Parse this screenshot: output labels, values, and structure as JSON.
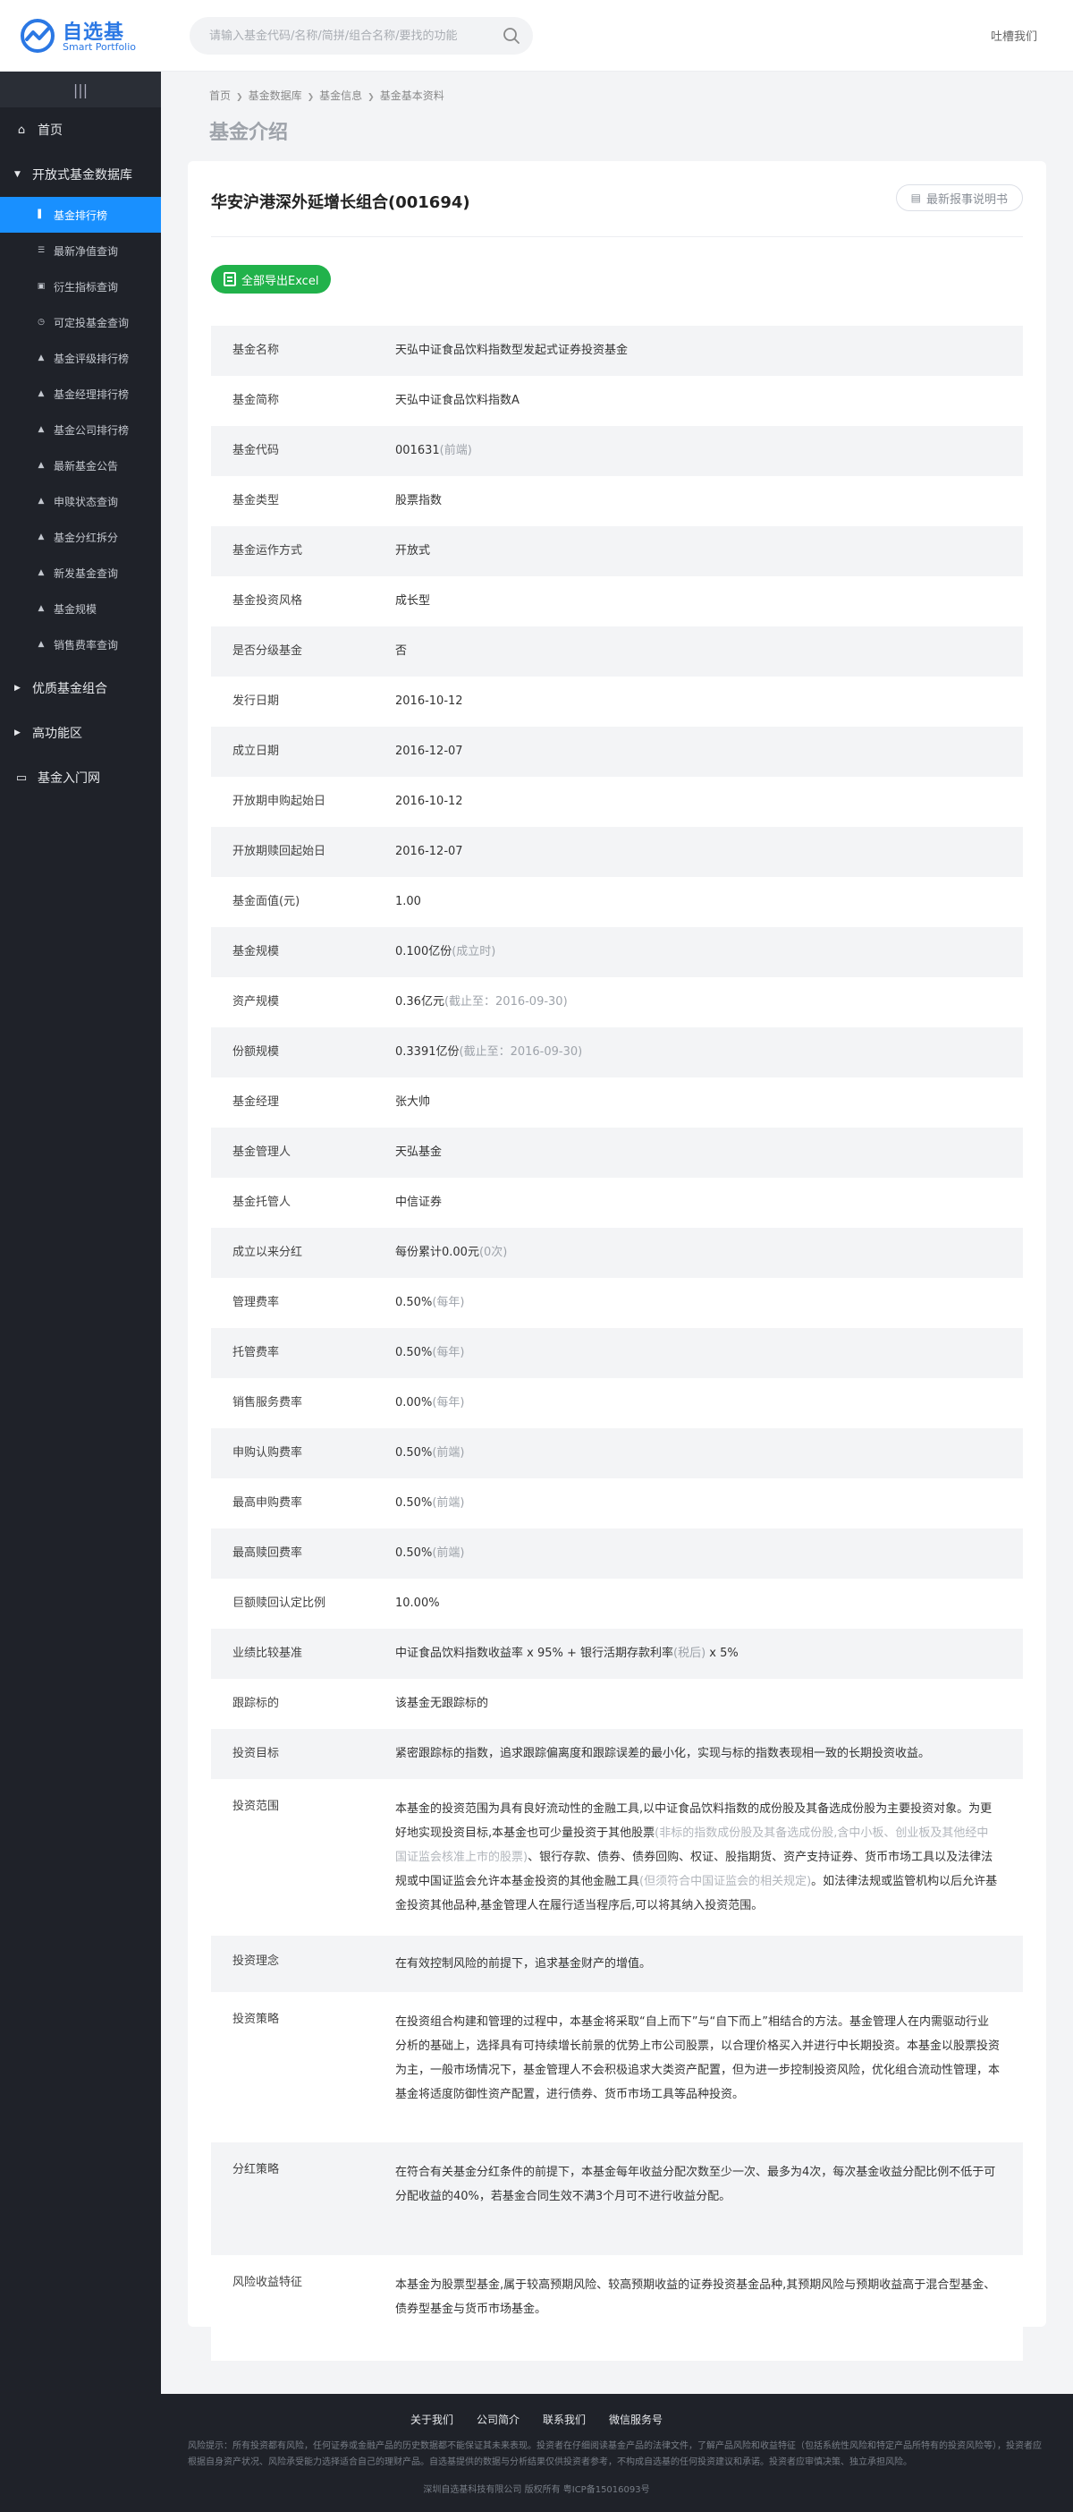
{
  "app": {
    "logo_name": "自选基",
    "logo_sub": "Smart Portfolio",
    "search_placeholder": "请输入基金代码/名称/简拼/组合名称/要找的功能",
    "feedback": "吐槽我们"
  },
  "sidebar": {
    "collapse_glyph": "|||",
    "home": "首页",
    "group_open": "开放式基金数据库",
    "items": [
      {
        "label": "基金排行榜",
        "icon": "bar-chart-icon",
        "glyph": "▌",
        "active": true
      },
      {
        "label": "最新净值查询",
        "icon": "database-icon",
        "glyph": "☰",
        "active": false
      },
      {
        "label": "衍生指标查询",
        "icon": "image-icon",
        "glyph": "▣",
        "active": false
      },
      {
        "label": "可定投基金查询",
        "icon": "clock-icon",
        "glyph": "◷",
        "active": false
      },
      {
        "label": "基金评级排行榜",
        "icon": "triangle-icon",
        "glyph": "▲",
        "active": false
      },
      {
        "label": "基金经理排行榜",
        "icon": "triangle-icon",
        "glyph": "▲",
        "active": false
      },
      {
        "label": "基金公司排行榜",
        "icon": "triangle-icon",
        "glyph": "▲",
        "active": false
      },
      {
        "label": "最新基金公告",
        "icon": "triangle-icon",
        "glyph": "▲",
        "active": false
      },
      {
        "label": "申赎状态查询",
        "icon": "triangle-icon",
        "glyph": "▲",
        "active": false
      },
      {
        "label": "基金分红拆分",
        "icon": "triangle-icon",
        "glyph": "▲",
        "active": false
      },
      {
        "label": "新发基金查询",
        "icon": "triangle-icon",
        "glyph": "▲",
        "active": false
      },
      {
        "label": "基金规模",
        "icon": "triangle-icon",
        "glyph": "▲",
        "active": false
      },
      {
        "label": "销售费率查询",
        "icon": "triangle-icon",
        "glyph": "▲",
        "active": false
      }
    ],
    "group_2": "优质基金组合",
    "group_3": "高功能区",
    "intro": "基金入门网"
  },
  "breadcrumb": [
    "首页",
    "基金数据库",
    "基金信息",
    "基金基本资料"
  ],
  "page_title": "基金介绍",
  "card": {
    "fund_title": "华安沪港深外延增长组合(001694)",
    "guide_button": "最新报事说明书",
    "export_button": "全部导出Excel"
  },
  "rows": [
    {
      "label": "基金名称",
      "value": "天弘中证食品饮料指数型发起式证券投资基金"
    },
    {
      "label": "基金简称",
      "value": "天弘中证食品饮料指数A"
    },
    {
      "label": "基金代码",
      "value": "001631",
      "note": "(前端)"
    },
    {
      "label": "基金类型",
      "value": "股票指数"
    },
    {
      "label": "基金运作方式",
      "value": "开放式"
    },
    {
      "label": "基金投资风格",
      "value": "成长型"
    },
    {
      "label": "是否分级基金",
      "value": "否"
    },
    {
      "label": "发行日期",
      "value": "2016-10-12"
    },
    {
      "label": "成立日期",
      "value": "2016-12-07"
    },
    {
      "label": "开放期申购起始日",
      "value": "2016-10-12"
    },
    {
      "label": "开放期赎回起始日",
      "value": "2016-12-07"
    },
    {
      "label": "基金面值(元)",
      "value": "1.00"
    },
    {
      "label": "基金规模",
      "value": "0.100亿份",
      "note": "(成立时)"
    },
    {
      "label": "资产规模",
      "value": "0.36亿元",
      "note": "(截止至：2016-09-30)"
    },
    {
      "label": "份额规模",
      "value": "0.3391亿份",
      "note": "(截止至：2016-09-30)"
    },
    {
      "label": "基金经理",
      "value": "张大帅"
    },
    {
      "label": "基金管理人",
      "value": "天弘基金"
    },
    {
      "label": "基金托管人",
      "value": "中信证券"
    },
    {
      "label": "成立以来分红",
      "value": "每份累计0.00元",
      "note": "(0次)"
    },
    {
      "label": "管理费率",
      "value": "0.50%",
      "note": "(每年)"
    },
    {
      "label": "托管费率",
      "value": "0.50%",
      "note": "(每年)"
    },
    {
      "label": "销售服务费率",
      "value": "0.00%",
      "note": "(每年)"
    },
    {
      "label": "申购认购费率",
      "value": "0.50%",
      "note": "(前端)"
    },
    {
      "label": "最高申购费率",
      "value": "0.50%",
      "note": "(前端)"
    },
    {
      "label": "最高赎回费率",
      "value": "0.50%",
      "note": "(前端)"
    },
    {
      "label": "巨额赎回认定比例",
      "value": "10.00%"
    },
    {
      "label": "业绩比较基准",
      "value": "中证食品饮料指数收益率 x 95% + 银行活期存款利率",
      "note": "(税后)",
      "tail": " x 5%"
    },
    {
      "label": "跟踪标的",
      "value": "该基金无跟踪标的"
    },
    {
      "label": "投资目标",
      "value": "紧密跟踪标的指数，追求跟踪偏离度和跟踪误差的最小化，实现与标的指数表现相一致的长期投资收益。"
    }
  ],
  "long_rows": [
    {
      "label": "投资范围",
      "part1": "本基金的投资范围为具有良好流动性的金融工具,以中证食品饮料指数的成份股及其备选成份股为主要投资对象。为更好地实现投资目标,本基金也可少量投资于其他股票",
      "faded1": "(非标的指数成份股及其备选成份股,含中小板、创业板及其他经中国证监会核准上市的股票)",
      "part2": "、银行存款、债券、债券回购、权证、股指期货、资产支持证券、货币市场工具以及法律法规或中国证监会允许本基金投资的其他金融工具",
      "faded2": "(但须符合中国证监会的相关规定)",
      "part3": "。如法律法规或监管机构以后允许基金投资其他品种,基金管理人在履行适当程序后,可以将其纳入投资范围。"
    },
    {
      "label": "投资理念",
      "text": "在有效控制风险的前提下，追求基金财产的增值。"
    },
    {
      "label": "投资策略",
      "text": "在投资组合构建和管理的过程中，本基金将采取“自上而下”与“自下而上”相结合的方法。基金管理人在内需驱动行业分析的基础上，选择具有可持续增长前景的优势上市公司股票，以合理价格买入并进行中长期投资。本基金以股票投资为主，一般市场情况下，基金管理人不会积极追求大类资产配置，但为进一步控制投资风险，优化组合流动性管理，本基金将适度防御性资产配置，进行债券、货币市场工具等品种投资。"
    },
    {
      "label": "分红策略",
      "text": "在符合有关基金分红条件的前提下，本基金每年收益分配次数至少一次、最多为4次，每次基金收益分配比例不低于可分配收益的40%，若基金合同生效不满3个月可不进行收益分配。"
    },
    {
      "label": "风险收益特征",
      "text": "本基金为股票型基金,属于较高预期风险、较高预期收益的证券投资基金品种,其预期风险与预期收益高于混合型基金、债券型基金与货币市场基金。"
    }
  ],
  "footer": {
    "links": [
      "关于我们",
      "公司简介",
      "联系我们",
      "微信服务号"
    ],
    "notice": "风险提示：所有投资都有风险，任何证券或金融产品的历史数据都不能保证其未来表现。投资者在仔细阅读基金产品的法律文件，了解产品风险和收益特征（包括系统性风险和特定产品所特有的投资风险等），投资者应根据自身资产状况、风险承受能力选择适合自己的理财产品。自选基提供的数据与分析结果仅供投资者参考，不构成自选基的任何投资建议和承诺。投资者应审慎决策、独立承担风险。",
    "copyright": "深圳自选基科技有限公司 版权所有 粤ICP备15016093号"
  }
}
